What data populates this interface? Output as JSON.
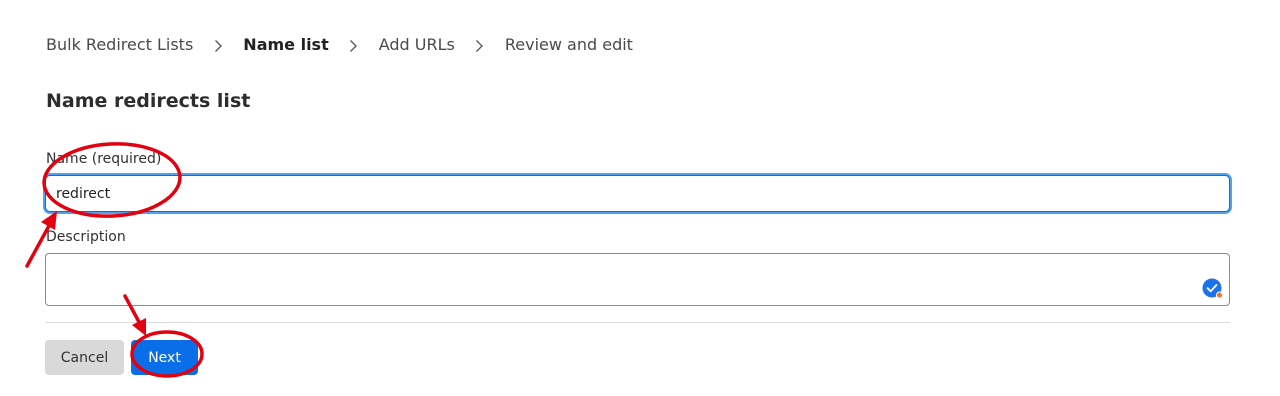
{
  "breadcrumb": {
    "items": [
      {
        "label": "Bulk Redirect Lists",
        "current": false
      },
      {
        "label": "Name list",
        "current": true
      },
      {
        "label": "Add URLs",
        "current": false
      },
      {
        "label": "Review and edit",
        "current": false
      }
    ],
    "separator_icon": "chevron-right-icon"
  },
  "form": {
    "title": "Name redirects list",
    "name_label": "Name (required)",
    "name_value": "redirect",
    "description_label": "Description",
    "description_value": ""
  },
  "actions": {
    "cancel_label": "Cancel",
    "next_label": "Next"
  },
  "colors": {
    "primary": "#0a6ee8",
    "focus_ring": "#4da3f0",
    "annotation": "#e3000f",
    "cancel_bg": "#d9d9d9"
  }
}
